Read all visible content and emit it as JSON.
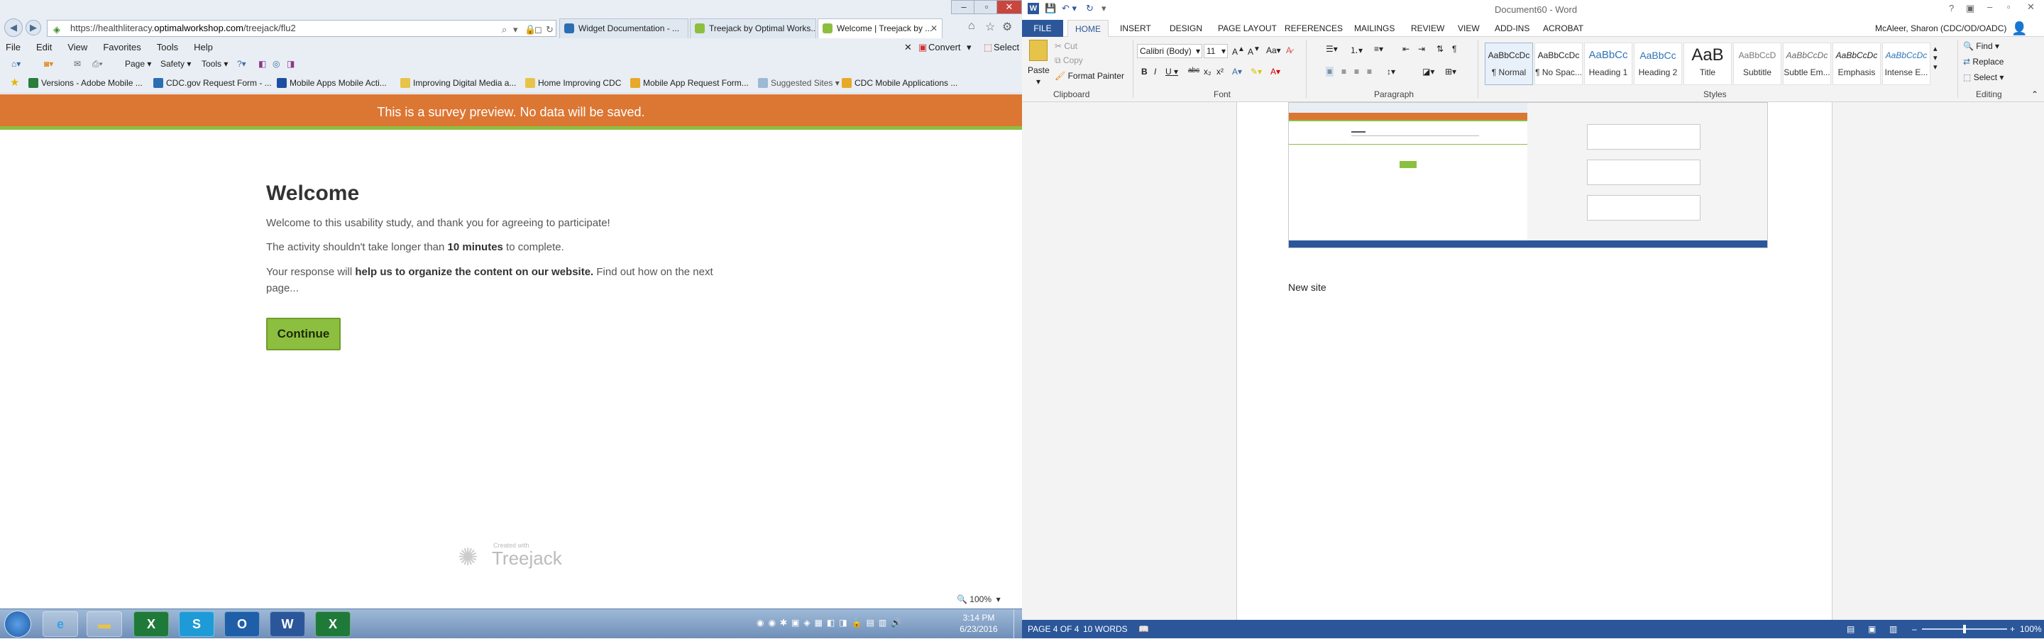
{
  "browser": {
    "address_url_prefix": "https://healthliteracy.",
    "address_url_domain": "optimalworkshop.com",
    "address_url_path": "/treejack/flu2",
    "tabs": [
      {
        "title": "Widget Documentation - ...",
        "active": false
      },
      {
        "title": "Treejack by Optimal Works...",
        "active": false
      },
      {
        "title": "Welcome | Treejack by ...",
        "active": true
      }
    ],
    "menu": [
      "File",
      "Edit",
      "View",
      "Favorites",
      "Tools",
      "Help"
    ],
    "command_bar": {
      "page": "Page",
      "safety": "Safety",
      "tools": "Tools",
      "convert": "Convert",
      "select": "Select"
    },
    "favorites": [
      "Versions - Adobe Mobile ...",
      "CDC.gov Request Form - ...",
      "Mobile Apps  Mobile Acti...",
      "Improving Digital Media a...",
      "Home  Improving CDC",
      "Mobile App Request Form...",
      "Suggested Sites",
      "CDC Mobile Applications ..."
    ],
    "zoom": "100%"
  },
  "survey": {
    "banner": "This is a survey preview. No data will be saved.",
    "title": "Welcome",
    "intro": "Welcome to this usability study, and thank you for agreeing to participate!",
    "duration_pre": "The activity shouldn't take longer than ",
    "duration_bold": "10 minutes",
    "duration_post": " to complete.",
    "response_pre": "Your response will ",
    "response_bold": "help us to organize the content on our website.",
    "response_post": " Find out how on the next page...",
    "continue_label": "Continue",
    "footer_small": "Created with",
    "footer_brand": "Treejack"
  },
  "word": {
    "title": "Document60 - Word",
    "user": "McAleer, Sharon (CDC/OD/OADC)",
    "tabs": [
      "FILE",
      "HOME",
      "INSERT",
      "DESIGN",
      "PAGE LAYOUT",
      "REFERENCES",
      "MAILINGS",
      "REVIEW",
      "VIEW",
      "ADD-INS",
      "ACROBAT"
    ],
    "clipboard": {
      "paste": "Paste",
      "cut": "Cut",
      "copy": "Copy",
      "format_painter": "Format Painter",
      "label": "Clipboard"
    },
    "font": {
      "name": "Calibri (Body)",
      "size": "11",
      "label": "Font"
    },
    "paragraph_label": "Paragraph",
    "styles_label": "Styles",
    "editing": {
      "find": "Find",
      "replace": "Replace",
      "select": "Select",
      "label": "Editing"
    },
    "styles": [
      {
        "sample": "AaBbCcDc",
        "name": "¶ Normal"
      },
      {
        "sample": "AaBbCcDc",
        "name": "¶ No Spac..."
      },
      {
        "sample": "AaBbCc",
        "name": "Heading 1"
      },
      {
        "sample": "AaBbCc",
        "name": "Heading 2"
      },
      {
        "sample": "AaB",
        "name": "Title"
      },
      {
        "sample": "AaBbCcD",
        "name": "Subtitle"
      },
      {
        "sample": "AaBbCcDc",
        "name": "Subtle Em..."
      },
      {
        "sample": "AaBbCcDc",
        "name": "Emphasis"
      },
      {
        "sample": "AaBbCcDc",
        "name": "Intense E..."
      }
    ],
    "doc_text": "New site",
    "status": {
      "page": "PAGE 4 OF 4",
      "words": "10 WORDS",
      "zoom": "100%"
    }
  },
  "taskbar": {
    "time": "3:14 PM",
    "date": "6/23/2016"
  },
  "colors": {
    "banner": "#dc7633",
    "accent_green": "#8cbf3f",
    "word_blue": "#2b579a"
  }
}
